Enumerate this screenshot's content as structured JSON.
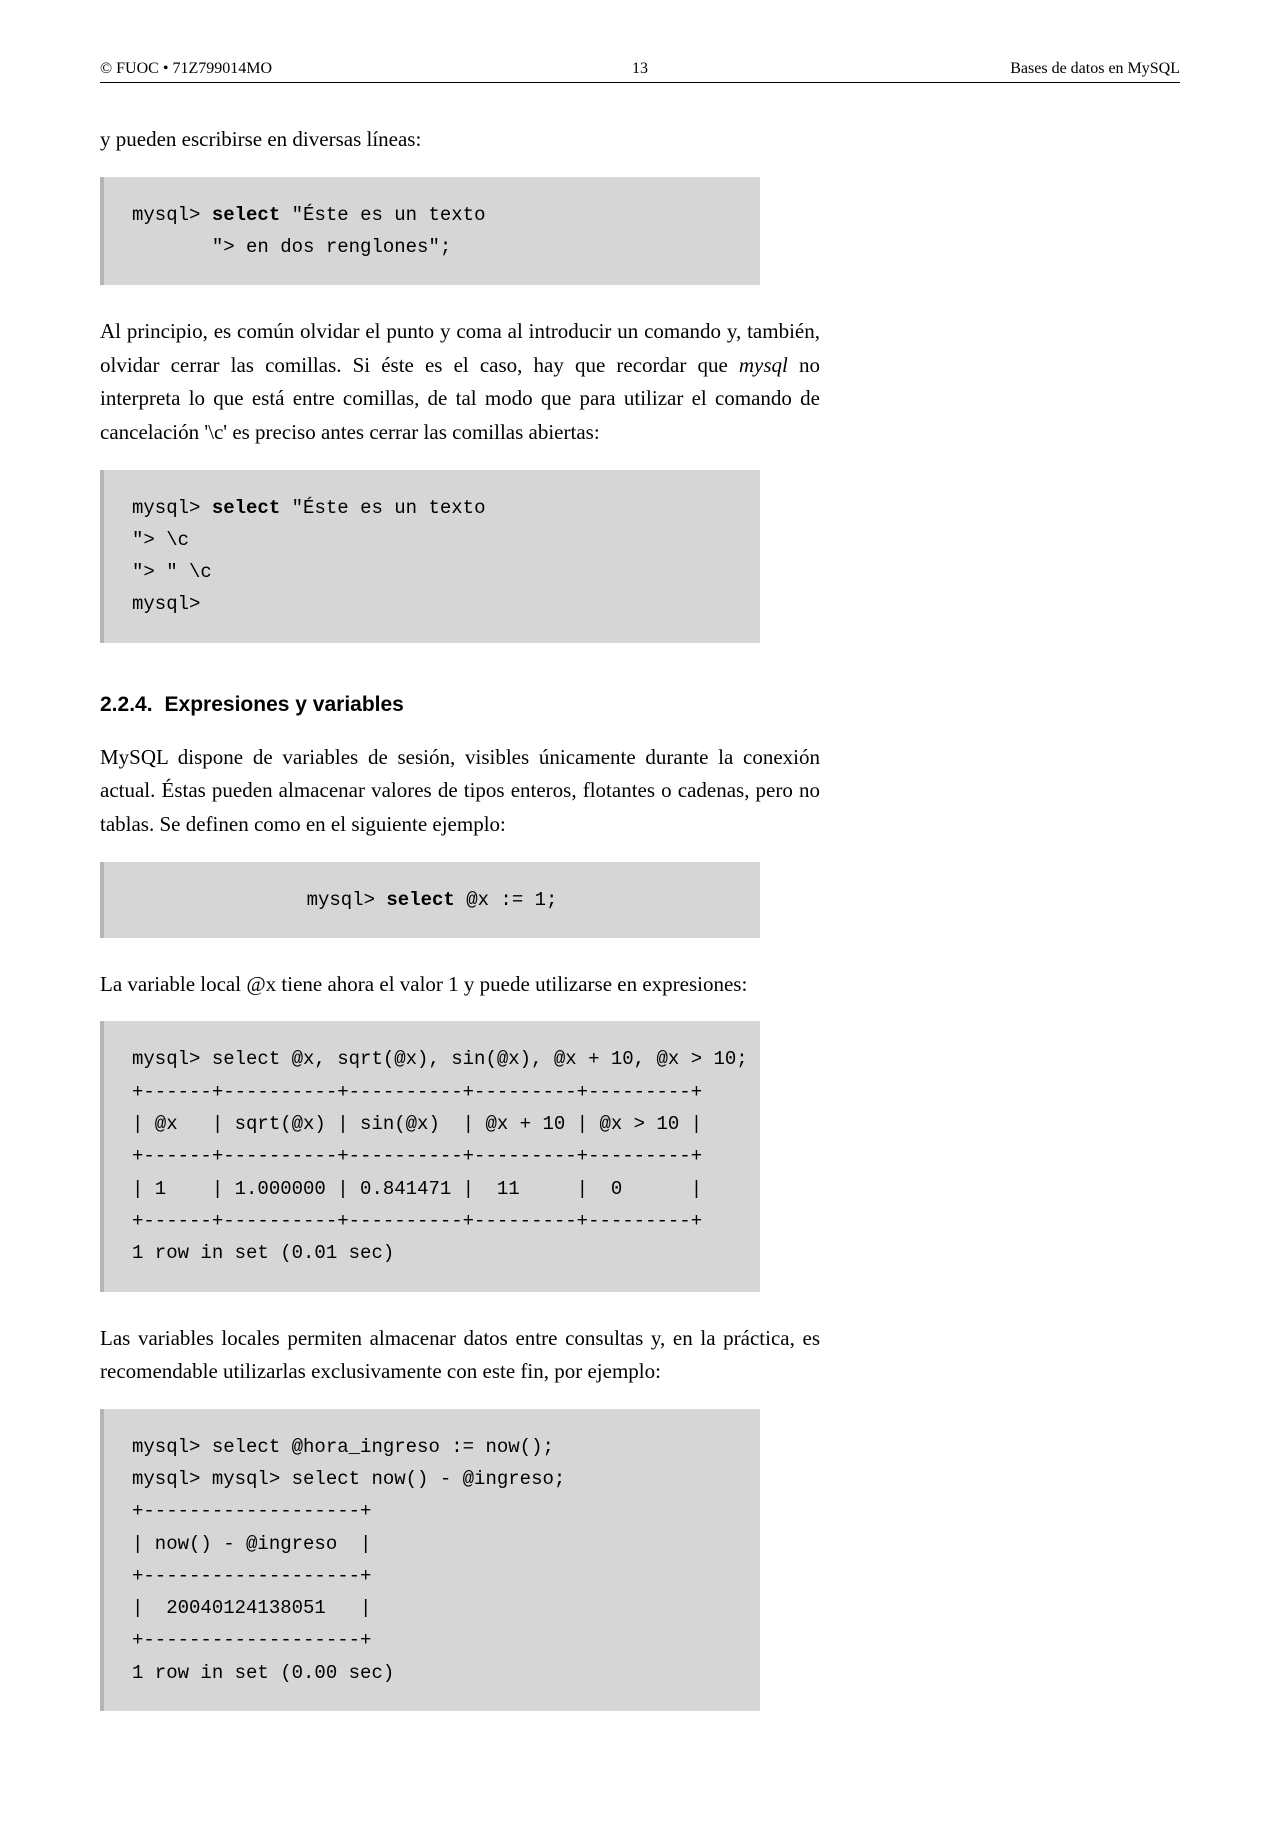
{
  "header": {
    "left": "© FUOC • 71Z799014MO",
    "center": "13",
    "right": "Bases de datos en MySQL"
  },
  "para1": "y pueden escribirse en diversas líneas:",
  "code1_l1_pre": "mysql> ",
  "code1_l1_bold": "select",
  "code1_l1_post": " \"Éste es un texto",
  "code1_l2": "       \"> en dos renglones\";",
  "para2_part1": "Al principio, es común olvidar el punto y coma al introducir un comando y, también, olvidar cerrar las comillas. Si éste es el caso, hay que recordar que ",
  "para2_italic": "mysql",
  "para2_part2": " no interpreta lo que está entre comillas, de tal modo que para utilizar el comando de cancelación '\\c' es preciso antes cerrar las comillas abiertas:",
  "code2_l1_pre": "mysql> ",
  "code2_l1_bold": "select",
  "code2_l1_post": " \"Éste es un texto",
  "code2_l2": "\"> \\c",
  "code2_l3": "\"> \" \\c",
  "code2_l4": "mysql>",
  "heading_num": "2.2.4.",
  "heading_text": "Expresiones y variables",
  "para3": "MySQL dispone de variables de sesión, visibles únicamente durante la conexión actual. Éstas pueden almacenar valores de tipos enteros, flotantes o cadenas, pero no tablas. Se definen como en el siguiente ejemplo:",
  "code3_pre": "mysql> ",
  "code3_bold": "select",
  "code3_post": " @x := 1;",
  "para4": "La variable local @x tiene ahora el valor 1 y puede utilizarse en expresiones:",
  "code4": "mysql> select @x, sqrt(@x), sin(@x), @x + 10, @x > 10;\n+------+----------+----------+---------+---------+\n| @x   | sqrt(@x) | sin(@x)  | @x + 10 | @x > 10 |\n+------+----------+----------+---------+---------+\n| 1    | 1.000000 | 0.841471 |  11     |  0      |\n+------+----------+----------+---------+---------+\n1 row in set (0.01 sec)",
  "para5": "Las variables locales permiten almacenar datos entre consultas y, en la práctica, es recomendable utilizarlas exclusivamente con este fin, por ejemplo:",
  "code5": "mysql> select @hora_ingreso := now();\nmysql> mysql> select now() - @ingreso;\n+-------------------+\n| now() - @ingreso  |\n+-------------------+\n|  20040124138051   |\n+-------------------+\n1 row in set (0.00 sec)",
  "chart_data": {
    "type": "table",
    "title": "select @x, sqrt(@x), sin(@x), @x + 10, @x > 10",
    "columns": [
      "@x",
      "sqrt(@x)",
      "sin(@x)",
      "@x + 10",
      "@x > 10"
    ],
    "rows": [
      [
        1,
        1.0,
        0.841471,
        11,
        0
      ]
    ],
    "footer": "1 row in set (0.01 sec)"
  }
}
